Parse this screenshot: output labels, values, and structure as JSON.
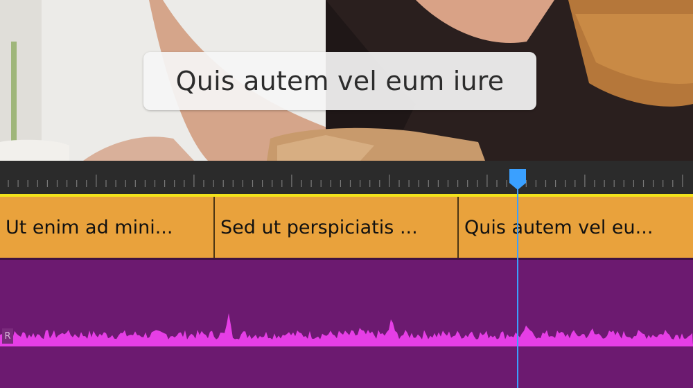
{
  "preview": {
    "caption_text": "Quis autem vel eum iure"
  },
  "caption_track": {
    "clips": [
      {
        "label": "Ut enim ad mini..."
      },
      {
        "label": "Sed ut perspiciatis ..."
      },
      {
        "label": "Quis autem vel eu..."
      }
    ]
  },
  "audio_track": {
    "channel_label": "R"
  },
  "colors": {
    "caption_track": "#e9a23c",
    "caption_track_border": "#f2e21c",
    "audio_track": "#6c1a70",
    "waveform": "#e63ee6",
    "playhead": "#3aa0ff",
    "ruler": "#2b2b2b"
  },
  "icons": {
    "playhead": "playhead-marker-icon"
  }
}
